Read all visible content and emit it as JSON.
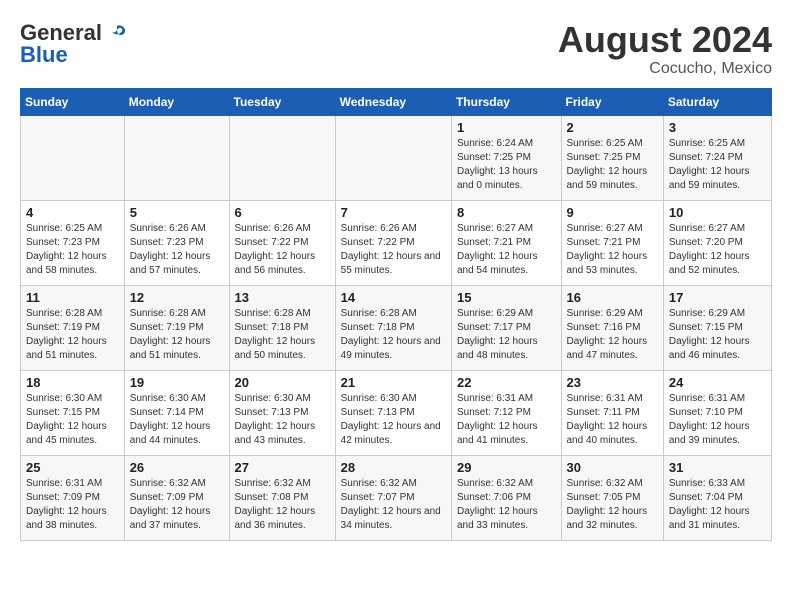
{
  "header": {
    "logo_general": "General",
    "logo_blue": "Blue",
    "month_year": "August 2024",
    "location": "Cocucho, Mexico"
  },
  "days_of_week": [
    "Sunday",
    "Monday",
    "Tuesday",
    "Wednesday",
    "Thursday",
    "Friday",
    "Saturday"
  ],
  "weeks": [
    [
      {
        "day": "",
        "sunrise": "",
        "sunset": "",
        "daylight": ""
      },
      {
        "day": "",
        "sunrise": "",
        "sunset": "",
        "daylight": ""
      },
      {
        "day": "",
        "sunrise": "",
        "sunset": "",
        "daylight": ""
      },
      {
        "day": "",
        "sunrise": "",
        "sunset": "",
        "daylight": ""
      },
      {
        "day": "1",
        "sunrise": "6:24 AM",
        "sunset": "7:25 PM",
        "daylight": "13 hours and 0 minutes."
      },
      {
        "day": "2",
        "sunrise": "6:25 AM",
        "sunset": "7:25 PM",
        "daylight": "12 hours and 59 minutes."
      },
      {
        "day": "3",
        "sunrise": "6:25 AM",
        "sunset": "7:24 PM",
        "daylight": "12 hours and 59 minutes."
      }
    ],
    [
      {
        "day": "4",
        "sunrise": "6:25 AM",
        "sunset": "7:23 PM",
        "daylight": "12 hours and 58 minutes."
      },
      {
        "day": "5",
        "sunrise": "6:26 AM",
        "sunset": "7:23 PM",
        "daylight": "12 hours and 57 minutes."
      },
      {
        "day": "6",
        "sunrise": "6:26 AM",
        "sunset": "7:22 PM",
        "daylight": "12 hours and 56 minutes."
      },
      {
        "day": "7",
        "sunrise": "6:26 AM",
        "sunset": "7:22 PM",
        "daylight": "12 hours and 55 minutes."
      },
      {
        "day": "8",
        "sunrise": "6:27 AM",
        "sunset": "7:21 PM",
        "daylight": "12 hours and 54 minutes."
      },
      {
        "day": "9",
        "sunrise": "6:27 AM",
        "sunset": "7:21 PM",
        "daylight": "12 hours and 53 minutes."
      },
      {
        "day": "10",
        "sunrise": "6:27 AM",
        "sunset": "7:20 PM",
        "daylight": "12 hours and 52 minutes."
      }
    ],
    [
      {
        "day": "11",
        "sunrise": "6:28 AM",
        "sunset": "7:19 PM",
        "daylight": "12 hours and 51 minutes."
      },
      {
        "day": "12",
        "sunrise": "6:28 AM",
        "sunset": "7:19 PM",
        "daylight": "12 hours and 51 minutes."
      },
      {
        "day": "13",
        "sunrise": "6:28 AM",
        "sunset": "7:18 PM",
        "daylight": "12 hours and 50 minutes."
      },
      {
        "day": "14",
        "sunrise": "6:28 AM",
        "sunset": "7:18 PM",
        "daylight": "12 hours and 49 minutes."
      },
      {
        "day": "15",
        "sunrise": "6:29 AM",
        "sunset": "7:17 PM",
        "daylight": "12 hours and 48 minutes."
      },
      {
        "day": "16",
        "sunrise": "6:29 AM",
        "sunset": "7:16 PM",
        "daylight": "12 hours and 47 minutes."
      },
      {
        "day": "17",
        "sunrise": "6:29 AM",
        "sunset": "7:15 PM",
        "daylight": "12 hours and 46 minutes."
      }
    ],
    [
      {
        "day": "18",
        "sunrise": "6:30 AM",
        "sunset": "7:15 PM",
        "daylight": "12 hours and 45 minutes."
      },
      {
        "day": "19",
        "sunrise": "6:30 AM",
        "sunset": "7:14 PM",
        "daylight": "12 hours and 44 minutes."
      },
      {
        "day": "20",
        "sunrise": "6:30 AM",
        "sunset": "7:13 PM",
        "daylight": "12 hours and 43 minutes."
      },
      {
        "day": "21",
        "sunrise": "6:30 AM",
        "sunset": "7:13 PM",
        "daylight": "12 hours and 42 minutes."
      },
      {
        "day": "22",
        "sunrise": "6:31 AM",
        "sunset": "7:12 PM",
        "daylight": "12 hours and 41 minutes."
      },
      {
        "day": "23",
        "sunrise": "6:31 AM",
        "sunset": "7:11 PM",
        "daylight": "12 hours and 40 minutes."
      },
      {
        "day": "24",
        "sunrise": "6:31 AM",
        "sunset": "7:10 PM",
        "daylight": "12 hours and 39 minutes."
      }
    ],
    [
      {
        "day": "25",
        "sunrise": "6:31 AM",
        "sunset": "7:09 PM",
        "daylight": "12 hours and 38 minutes."
      },
      {
        "day": "26",
        "sunrise": "6:32 AM",
        "sunset": "7:09 PM",
        "daylight": "12 hours and 37 minutes."
      },
      {
        "day": "27",
        "sunrise": "6:32 AM",
        "sunset": "7:08 PM",
        "daylight": "12 hours and 36 minutes."
      },
      {
        "day": "28",
        "sunrise": "6:32 AM",
        "sunset": "7:07 PM",
        "daylight": "12 hours and 34 minutes."
      },
      {
        "day": "29",
        "sunrise": "6:32 AM",
        "sunset": "7:06 PM",
        "daylight": "12 hours and 33 minutes."
      },
      {
        "day": "30",
        "sunrise": "6:32 AM",
        "sunset": "7:05 PM",
        "daylight": "12 hours and 32 minutes."
      },
      {
        "day": "31",
        "sunrise": "6:33 AM",
        "sunset": "7:04 PM",
        "daylight": "12 hours and 31 minutes."
      }
    ]
  ],
  "labels": {
    "sunrise": "Sunrise:",
    "sunset": "Sunset:",
    "daylight": "Daylight:"
  }
}
